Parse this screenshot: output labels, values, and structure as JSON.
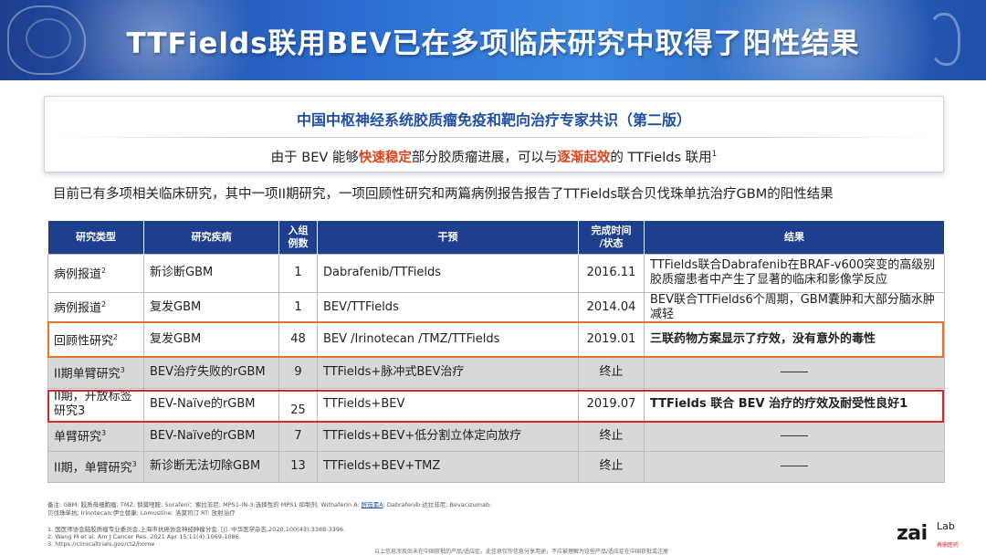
{
  "banner": {
    "title": "TTFields联用BEV已在多项临床研究中取得了阳性结果"
  },
  "consensus": {
    "title": "中国中枢神经系统胶质瘤免疫和靶向治疗专家共识（第二版）",
    "text_1": "由于 BEV 能够",
    "highlight_1": "快速稳定",
    "text_2": "部分胶质瘤进展，可以与",
    "highlight_2": "逐渐起效",
    "text_3": "的 TTFields 联用",
    "sup": "1"
  },
  "intro": "目前已有多项相关临床研究，其中一项II期研究，一项回顾性研究和两篇病例报告报告了TTFields联合贝伐珠单抗治疗GBM的阳性结果",
  "table": {
    "headers": {
      "type": "研究类型",
      "disease": "研究疾病",
      "n_line1": "入组",
      "n_line2": "例数",
      "intervention": "干预",
      "time_line1": "完成时间",
      "time_line2": "/状态",
      "result": "结果"
    },
    "rows": [
      {
        "type": "病例报道",
        "sup": "2",
        "disease": "新诊断GBM",
        "n": "1",
        "intervention": "Dabrafenib/TTFields",
        "time": "2016.11",
        "result": "TTFields联合Dabrafenib在BRAF-v600突变的高级别胶质瘤患者中产生了显著的临床和影像学反应"
      },
      {
        "type": "病例报道",
        "sup": "2",
        "disease": "复发GBM",
        "n": "1",
        "intervention": "BEV/TTFields",
        "time": "2014.04",
        "result": "BEV联合TTFields6个周期，GBM囊肿和大部分脑水肿减轻"
      },
      {
        "type": "回顾性研究",
        "sup": "2",
        "disease": "复发GBM",
        "n": "48",
        "intervention": "BEV /Irinotecan /TMZ/TTFields",
        "time": "2019.01",
        "result": "三联药物方案显示了疗效，没有意外的毒性"
      },
      {
        "type": "II期单臂研究",
        "sup": "3",
        "disease": "BEV治疗失败的rGBM",
        "n": "9",
        "intervention": "TTFields+脉冲式BEV治疗",
        "time": "终止",
        "result": ""
      },
      {
        "type": "II期，开放标签研究3",
        "sup": "",
        "disease": "BEV-Naïve的rGBM",
        "n": "25",
        "intervention": "TTFields+BEV",
        "time": "2019.07",
        "result": "TTFields 联合 BEV 治疗的疗效及耐受性良好1"
      },
      {
        "type": "单臂研究",
        "sup": "3",
        "disease": "BEV-Naïve的rGBM",
        "n": "7",
        "intervention": "TTFields+BEV+低分割立体定向放疗",
        "time": "终止",
        "result": ""
      },
      {
        "type": "II期，单臂研究",
        "sup": "3",
        "disease": "新诊断无法切除GBM",
        "n": "13",
        "intervention": "TTFields+BEV+TMZ",
        "time": "终止",
        "result": ""
      }
    ]
  },
  "notes": {
    "line1_a": "备注: GBM: 胶质母细胞瘤; TMZ: 替莫唑胺; Sorafeni：索拉非尼; MPS1-IN-3:选择性的 MPS1 抑制剂; Withaferin A: ",
    "line1_link": "醉茄素A",
    "line1_b": "; Dabrafenib:达拉非尼; Bevacizumab:",
    "line2": "贝伐珠单抗; Irinotecan:伊立替康; Lomustine: 洛莫司汀 RT: 放射治疗"
  },
  "refs": [
    "1. 国医师协会脑胶质瘤专业委员会,上海市抗癌协会神经肿瘤分会. [J]. 中华医学杂志,2020,100(43):3388-3396.",
    "2. Wang M et al. Am J Cancer Res. 2021 Apr 15;11(4):1069-1086.",
    "3. https://clinicaltrials.gov/ct2/home"
  ],
  "disclaimer": "以上信息涉及尚未在中国获批的产品/适应症。此信息仅作信息分享用途，不应被理解为这些产品/适应症在中国获批或注册",
  "logo": {
    "main": "zai",
    "lab": "Lab",
    "sub": "再鼎医药"
  },
  "colors": {
    "banner": "#2a6ccf",
    "header_row": "#1d3f8e",
    "highlight_text": "#e0421b",
    "orange_box": "#e8742a",
    "red_box": "#d9232d",
    "gray_row": "#d8d8d8"
  }
}
